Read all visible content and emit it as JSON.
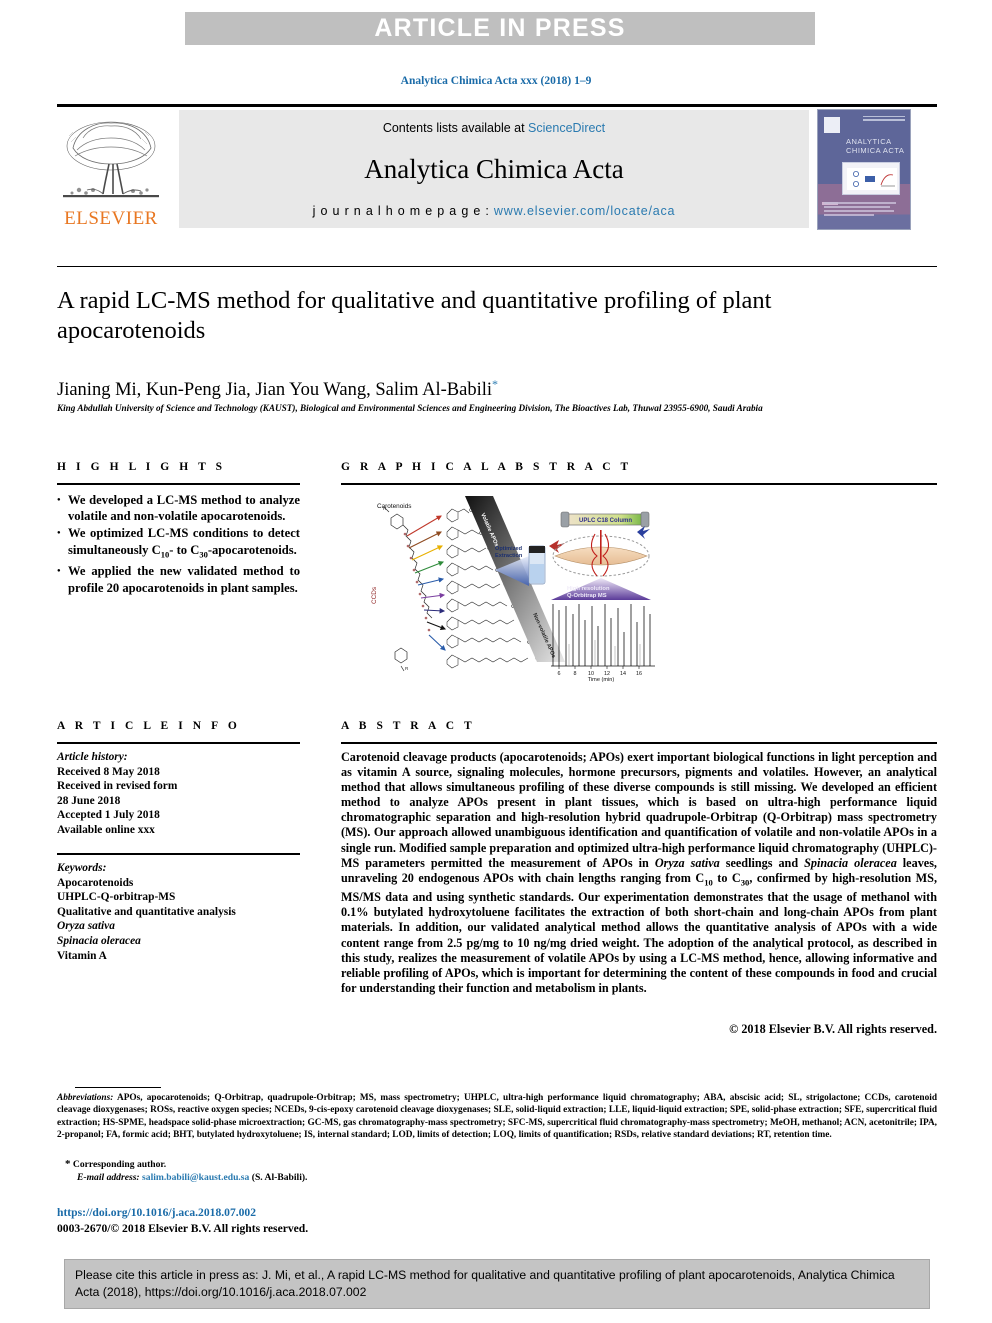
{
  "banner": {
    "text": "ARTICLE IN PRESS"
  },
  "running_head": "Analytica Chimica Acta xxx (2018) 1–9",
  "masthead": {
    "contents_prefix": "Contents lists available at ",
    "sciencedirect": "ScienceDirect",
    "journal_name": "Analytica Chimica Acta",
    "homepage_label": "j o u r n a l   h o m e p a g e :  ",
    "homepage_url": "www.elsevier.com/locate/aca",
    "publisher": "ELSEVIER",
    "cover_title": "ANALYTICA CHIMICA ACTA",
    "link_color": "#2a7ab0"
  },
  "article": {
    "title": "A rapid LC-MS method for qualitative and quantitative profiling of plant apocarotenoids",
    "authors": "Jianing Mi, Kun-Peng Jia, Jian You Wang, Salim Al-Babili",
    "corresponding_marker": "*",
    "affiliation": "King Abdullah University of Science and Technology (KAUST), Biological and Environmental Sciences and Engineering Division, The Bioactives Lab, Thuwal 23955-6900, Saudi Arabia"
  },
  "highlights": {
    "heading": "H I G H L I G H T S",
    "items": [
      "We developed a LC-MS method to analyze volatile and non-volatile apocarotenoids.",
      "We optimized LC-MS conditions to detect simultaneously C10- to C30-apocarotenoids.",
      "We applied the new validated method to profile 20 apocarotenoids in plant samples."
    ]
  },
  "graphical_abstract": {
    "heading": "G R A P H I C A L   A B S T R A C T",
    "labels": {
      "carotenoids": "Carotenoids",
      "ccds": "CCDs",
      "volatile": "Volatile APOs",
      "nonvolatile": "Non-volatile APOs",
      "extraction": "Optimized Extraction",
      "column": "UPLC C18 Column",
      "ms": "High resolution Q-Orbitrap MS",
      "x_axis": "Time (min)",
      "x_ticks": [
        "6",
        "8",
        "10",
        "12",
        "14",
        "16"
      ]
    }
  },
  "article_info": {
    "heading": "A R T I C L E   I N F O",
    "history_label": "Article history:",
    "history": [
      "Received 8 May 2018",
      "Received in revised form",
      "28 June 2018",
      "Accepted 1 July 2018",
      "Available online xxx"
    ],
    "keywords_label": "Keywords:",
    "keywords": [
      {
        "text": "Apocarotenoids",
        "italic": false
      },
      {
        "text": "UHPLC-Q-orbitrap-MS",
        "italic": false
      },
      {
        "text": "Qualitative and quantitative analysis",
        "italic": false
      },
      {
        "text": "Oryza sativa",
        "italic": true
      },
      {
        "text": "Spinacia oleracea",
        "italic": true
      },
      {
        "text": "Vitamin A",
        "italic": false
      }
    ]
  },
  "abstract": {
    "heading": "A B S T R A C T",
    "text": "Carotenoid cleavage products (apocarotenoids; APOs) exert important biological functions in light perception and as vitamin A source, signaling molecules, hormone precursors, pigments and volatiles. However, an analytical method that allows simultaneous profiling of these diverse compounds is still missing. We developed an efficient method to analyze APOs present in plant tissues, which is based on ultra-high performance liquid chromatographic separation and high-resolution hybrid quadrupole-Orbitrap (Q-Orbitrap) mass spectrometry (MS). Our approach allowed unambiguous identification and quantification of volatile and non-volatile APOs in a single run. Modified sample preparation and optimized ultra-high performance liquid chromatography (UHPLC)-MS parameters permitted the measurement of APOs in Oryza sativa seedlings and Spinacia oleracea leaves, unraveling 20 endogenous APOs with chain lengths ranging from C10 to C30, confirmed by high-resolution MS, MS/MS data and using synthetic standards. Our experimentation demonstrates that the usage of methanol with 0.1% butylated hydroxytoluene facilitates the extraction of both short-chain and long-chain APOs from plant materials. In addition, our validated analytical method allows the quantitative analysis of APOs with a wide content range from 2.5 pg/mg to 10 ng/mg dried weight. The adoption of the analytical protocol, as described in this study, realizes the measurement of volatile APOs by using a LC-MS method, hence, allowing informative and reliable profiling of APOs, which is important for determining the content of these compounds in food and crucial for understanding their function and metabolism in plants.",
    "copyright": "© 2018 Elsevier B.V. All rights reserved."
  },
  "footnotes": {
    "abbreviations_label": "Abbreviations:",
    "abbreviations": "APOs, apocarotenoids; Q-Orbitrap, quadrupole-Orbitrap; MS, mass spectrometry; UHPLC, ultra-high performance liquid chromatography; ABA, abscisic acid; SL, strigolactone; CCDs, carotenoid cleavage dioxygenases; ROSs, reactive oxygen species; NCEDs, 9-cis-epoxy carotenoid cleavage dioxygenases; SLE, solid-liquid extraction; LLE, liquid-liquid extraction; SPE, solid-phase extraction; SFE, supercritical fluid extraction; HS-SPME, headspace solid-phase microextraction; GC-MS, gas chromatography-mass spectrometry; SFC-MS, supercritical fluid chromatography-mass spectrometry; MeOH, methanol; ACN, acetonitrile; IPA, 2-propanol; FA, formic acid; BHT, butylated hydroxytoluene; IS, internal standard; LOD, limits of detection; LOQ, limits of quantification; RSDs, relative standard deviations; RT, retention time.",
    "corresponding": "Corresponding author.",
    "email_label": "E-mail address:",
    "email": "salim.babili@kaust.edu.sa",
    "email_owner": "(S. Al-Babili).",
    "doi": "https://doi.org/10.1016/j.aca.2018.07.002",
    "issn_line": "0003-2670/© 2018 Elsevier B.V. All rights reserved."
  },
  "cite_box": {
    "text": "Please cite this article in press as: J. Mi, et al., A rapid LC-MS method for qualitative and quantitative profiling of plant apocarotenoids, Analytica Chimica Acta (2018), https://doi.org/10.1016/j.aca.2018.07.002"
  }
}
